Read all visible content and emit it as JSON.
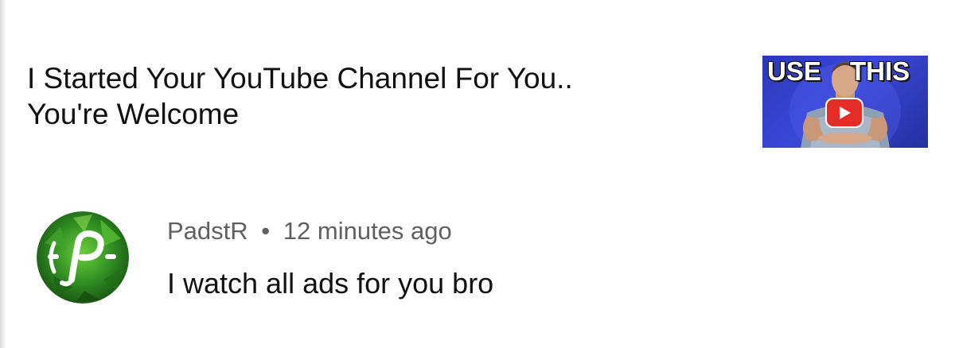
{
  "video": {
    "title": "I Started Your YouTube Channel For You..\nYou're Welcome",
    "thumbnail": {
      "text_left": "USE",
      "text_right": "THIS",
      "play_icon": "youtube-play-icon",
      "background_color": "#2f3cc4",
      "play_color": "#e52d27"
    }
  },
  "comment": {
    "avatar_icon": "padstr-logo-icon",
    "avatar_colors": [
      "#1f6b1a",
      "#4caf2c",
      "#8fd14f"
    ],
    "author": "PadstR",
    "separator": "•",
    "timestamp": "12 minutes ago",
    "text": "I watch all ads for you bro"
  }
}
